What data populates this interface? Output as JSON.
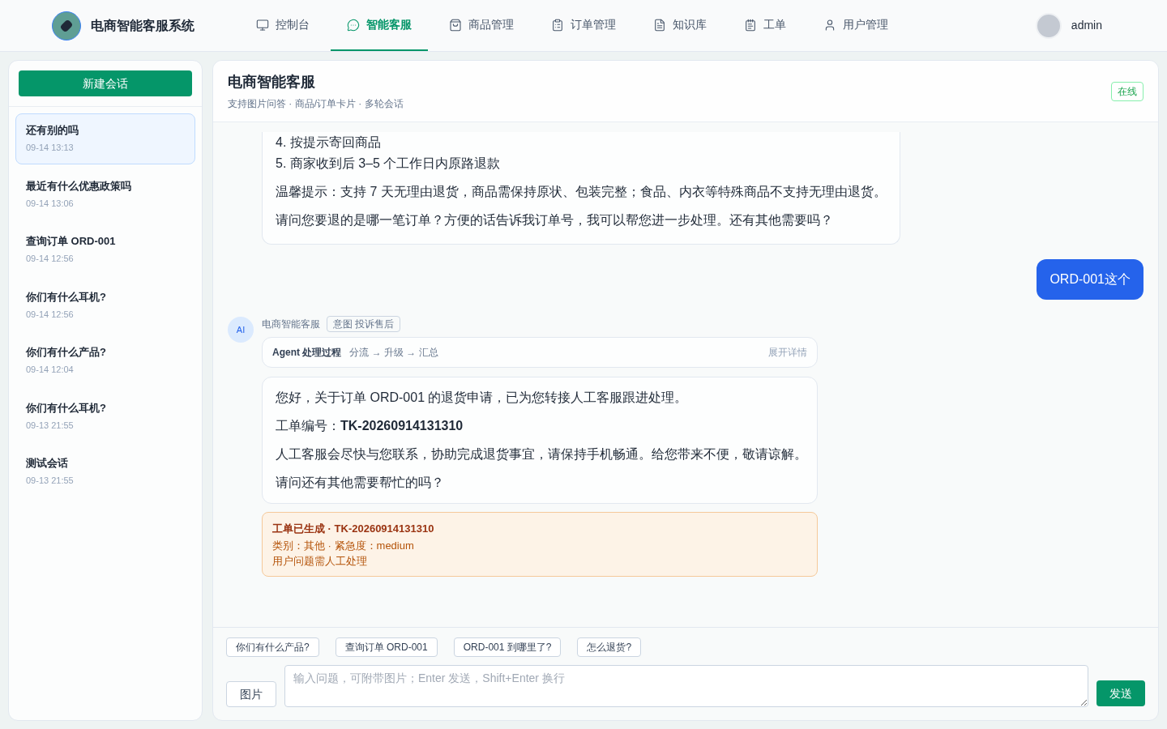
{
  "header": {
    "app_title": "电商智能客服系统",
    "nav": [
      {
        "label": "控制台",
        "selected": false
      },
      {
        "label": "智能客服",
        "selected": true
      },
      {
        "label": "商品管理",
        "selected": false
      },
      {
        "label": "订单管理",
        "selected": false
      },
      {
        "label": "知识库",
        "selected": false
      },
      {
        "label": "工单",
        "selected": false
      },
      {
        "label": "用户管理",
        "selected": false
      }
    ],
    "user": "admin"
  },
  "sidebar": {
    "new_button": "新建会话",
    "sessions": [
      {
        "title": "还有别的吗",
        "time": "09-14 13:13",
        "selected": true
      },
      {
        "title": "最近有什么优惠政策吗",
        "time": "09-14 13:06",
        "selected": false
      },
      {
        "title": "查询订单 ORD-001",
        "time": "09-14 12:56",
        "selected": false
      },
      {
        "title": "你们有什么耳机?",
        "time": "09-14 12:56",
        "selected": false
      },
      {
        "title": "你们有什么产品?",
        "time": "09-14 12:04",
        "selected": false
      },
      {
        "title": "你们有什么耳机?",
        "time": "09-13 21:55",
        "selected": false
      },
      {
        "title": "测试会话",
        "time": "09-13 21:55",
        "selected": false
      }
    ]
  },
  "chat": {
    "title": "电商智能客服",
    "subtitle": "支持图片问答 · 商品/订单卡片 · 多轮会话",
    "status": "在线",
    "messages": [
      {
        "kind": "bot_partial",
        "lines": [
          "4. 按提示寄回商品",
          "5. 商家收到后 3–5 个工作日内原路退款"
        ],
        "paragraphs": [
          "温馨提示：支持 7 天无理由退货，商品需保持原状、包装完整；食品、内衣等特殊商品不支持无理由退货。",
          "请问您要退的是哪一笔订单？方便的话告诉我订单号，我可以帮您进一步处理。还有其他需要吗？"
        ]
      },
      {
        "kind": "user",
        "text": "ORD-001这个"
      },
      {
        "kind": "bot",
        "avatar": "AI",
        "sender": "电商智能客服",
        "intent": "意图 投诉售后",
        "agent": {
          "label": "Agent 处理过程",
          "flow": "分流 → 升级 → 汇总",
          "toggle": "展开详情"
        },
        "paragraphs": [
          "您好，关于订单 ORD-001 的退货申请，已为您转接人工客服跟进处理。",
          "工单编号：**TK-20260914131310**",
          "人工客服会尽快与您联系，协助完成退货事宜，请保持手机畅通。给您带来不便，敬请谅解。",
          "请问还有其他需要帮忙的吗？"
        ],
        "ticket": {
          "title": "工单已生成 · TK-20260914131310",
          "meta": "类别：其他 · 紧急度：medium",
          "note": "用户问题需人工处理"
        }
      }
    ],
    "quick_questions": [
      "你们有什么产品?",
      "查询订单 ORD-001",
      "ORD-001 到哪里了?",
      "怎么退货?"
    ],
    "image_button": "图片",
    "input_placeholder": "输入问题，可附带图片；Enter 发送，Shift+Enter 换行",
    "send_button": "发送"
  }
}
